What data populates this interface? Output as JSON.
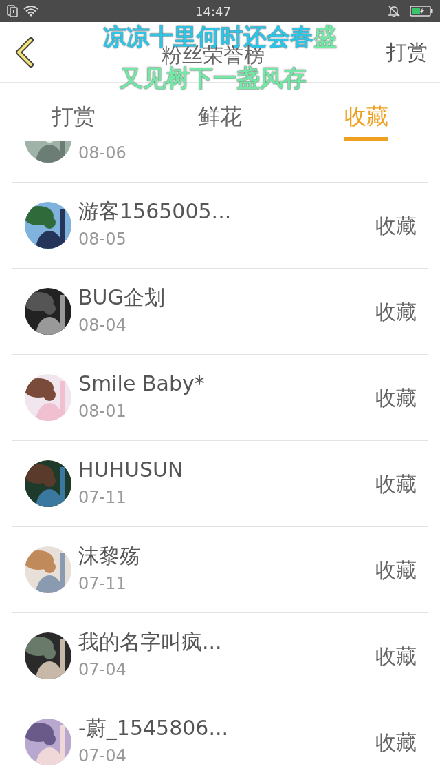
{
  "status_bar": {
    "time": "14:47"
  },
  "header": {
    "title": "粉丝荣誉榜",
    "action": "打赏"
  },
  "lyrics": [
    {
      "segments": [
        {
          "text": "凉凉十里何时还会春",
          "sung": true
        },
        {
          "text": "盛",
          "sung": false
        }
      ]
    },
    {
      "segments": [
        {
          "text": "又见树下一盏风存",
          "sung": false
        }
      ]
    }
  ],
  "tabs": [
    {
      "label": "打赏",
      "selected": false
    },
    {
      "label": "鲜花",
      "selected": false
    },
    {
      "label": "收藏",
      "selected": true
    }
  ],
  "rows": [
    {
      "date": "08-06"
    },
    {
      "name": "游客1565005...",
      "date": "08-05",
      "action": "收藏"
    },
    {
      "name": "BUG企划",
      "date": "08-04",
      "action": "收藏"
    },
    {
      "name": "Smile Baby*",
      "date": "08-01",
      "action": "收藏"
    },
    {
      "name": "HUHUSUN",
      "date": "07-11",
      "action": "收藏"
    },
    {
      "name": "沫黎殇",
      "date": "07-11",
      "action": "收藏"
    },
    {
      "name": "我的名字叫疯...",
      "date": "07-04",
      "action": "收藏"
    },
    {
      "name": "-蔚_1545806...",
      "date": "07-04",
      "action": "收藏"
    }
  ]
}
